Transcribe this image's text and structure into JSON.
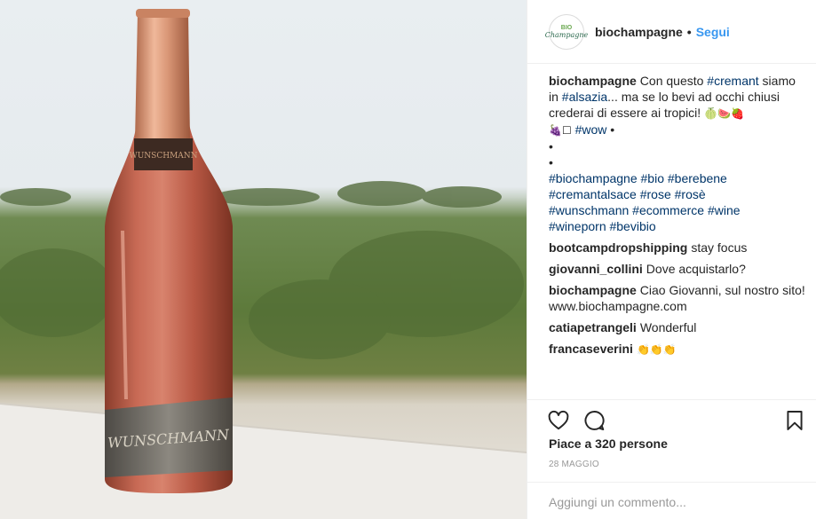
{
  "post": {
    "photo_alt": "",
    "label_text": "WUNSCHMANN"
  },
  "header": {
    "avatar_top": "BIO",
    "avatar_brand": "Champagne",
    "username": "biochampagne",
    "separator": "•",
    "follow_label": "Segui"
  },
  "caption": {
    "user": "biochampagne",
    "t1": "Con questo",
    "tag_cremant": "#cremant",
    "t2": "siamo in",
    "tag_alsazia": "#alsazia",
    "t3": "... ma se lo bevi ad occhi chiusi crederai di essere ai tropici!",
    "emojis1": "🍈🍉🍓",
    "emojis2": "🍇☐",
    "tag_wow": "#wow",
    "bullet_a": "•",
    "bullet_b": "•",
    "bullet_c": "•",
    "tags_line1": "#biochampagne #bio #berebene",
    "tags_line2": "#cremantalsace #rose #rosè",
    "tags_line3": "#wunschmann #ecommerce #wine",
    "tags_line4": "#wineporn #bevibio"
  },
  "comments": [
    {
      "user": "bootcampdropshipping",
      "text": "stay focus"
    },
    {
      "user": "giovanni_collini",
      "text": "Dove acquistarlo?"
    },
    {
      "user": "biochampagne",
      "text": "Ciao Giovanni, sul nostro sito! www.biochampagne.com"
    },
    {
      "user": "catiapetrangeli",
      "text": "Wonderful"
    },
    {
      "user": "francaseverini",
      "text": "👏👏👏"
    }
  ],
  "actions": {
    "like_icon": "heart-icon",
    "comment_icon": "comment-bubble-icon",
    "save_icon": "bookmark-icon"
  },
  "likes_text": "Piace a 320 persone",
  "date_text": "28 maggio",
  "add_comment": {
    "placeholder": "Aggiungi un commento..."
  },
  "colors": {
    "link": "#003569",
    "follow": "#3897f0",
    "text": "#262626",
    "muted": "#999999",
    "border": "#efefef"
  }
}
